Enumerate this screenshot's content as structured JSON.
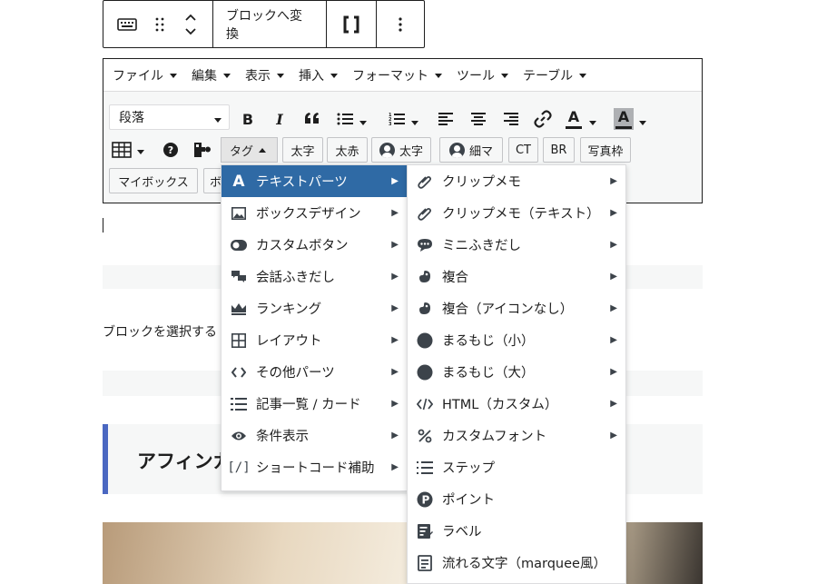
{
  "block_toolbar": {
    "convert_label": "ブロックへ変換",
    "bracket_label": "[ ]"
  },
  "classic_menu": [
    {
      "label": "ファイル"
    },
    {
      "label": "編集"
    },
    {
      "label": "表示"
    },
    {
      "label": "挿入"
    },
    {
      "label": "フォーマット"
    },
    {
      "label": "ツール"
    },
    {
      "label": "テーブル"
    }
  ],
  "toolbar": {
    "format_select": "段落",
    "bold": "B",
    "italic": "I",
    "quote": "❝",
    "link": "🔗",
    "text_color": "A",
    "bg_color": "A",
    "help": "?"
  },
  "quicktags": {
    "tag": "タグ",
    "bold_text": "太字",
    "bold_red": "太赤",
    "avatar_bold": "太字",
    "avatar_thin": "細マ",
    "ct": "CT",
    "br": "BR",
    "photo_frame": "写真枠",
    "mybox": "マイボックス",
    "next_partial": "ボ"
  },
  "page": {
    "prompt_text": "ブロックを選択する",
    "heading_text": "アフィンガ"
  },
  "menu1": [
    {
      "label": "テキストパーツ",
      "icon": "A",
      "icon_name": "text-a-icon",
      "submenu": true,
      "active": true
    },
    {
      "label": "ボックスデザイン",
      "icon": "box",
      "icon_name": "image-box-icon",
      "submenu": true
    },
    {
      "label": "カスタムボタン",
      "icon": "toggle",
      "icon_name": "toggle-icon",
      "submenu": true
    },
    {
      "label": "会話ふきだし",
      "icon": "chat",
      "icon_name": "chat-bubbles-icon",
      "submenu": true
    },
    {
      "label": "ランキング",
      "icon": "crown",
      "icon_name": "crown-icon",
      "submenu": true
    },
    {
      "label": "レイアウト",
      "icon": "grid",
      "icon_name": "grid-icon",
      "submenu": true
    },
    {
      "label": "その他パーツ",
      "icon": "code",
      "icon_name": "code-brackets-icon",
      "submenu": true
    },
    {
      "label": "記事一覧 / カード",
      "icon": "list",
      "icon_name": "list-icon",
      "submenu": true
    },
    {
      "label": "条件表示",
      "icon": "eye",
      "icon_name": "eye-icon",
      "submenu": true
    },
    {
      "label": "ショートコード補助",
      "icon": "shortcode",
      "icon_name": "shortcode-icon",
      "submenu": true
    }
  ],
  "menu2": [
    {
      "label": "クリップメモ",
      "icon": "clip",
      "icon_name": "paperclip-icon",
      "submenu": true
    },
    {
      "label": "クリップメモ（テキスト）",
      "icon": "clip",
      "icon_name": "paperclip-icon",
      "submenu": true
    },
    {
      "label": "ミニふきだし",
      "icon": "speech",
      "icon_name": "speech-bubble-icon",
      "submenu": true
    },
    {
      "label": "複合",
      "icon": "blob",
      "icon_name": "blob-icon",
      "submenu": true
    },
    {
      "label": "複合（アイコンなし）",
      "icon": "blob",
      "icon_name": "blob-icon",
      "submenu": true
    },
    {
      "label": "まるもじ（小）",
      "icon": "circle",
      "icon_name": "filled-circle-icon",
      "submenu": true
    },
    {
      "label": "まるもじ（大）",
      "icon": "circle",
      "icon_name": "filled-circle-icon",
      "submenu": true
    },
    {
      "label": "HTML（カスタム）",
      "icon": "html",
      "icon_name": "html-code-icon",
      "submenu": true
    },
    {
      "label": "カスタムフォント",
      "icon": "percent",
      "icon_name": "percent-icon",
      "submenu": true
    },
    {
      "label": "ステップ",
      "icon": "steps",
      "icon_name": "numbered-list-icon",
      "submenu": false
    },
    {
      "label": "ポイント",
      "icon": "point",
      "icon_name": "point-p-icon",
      "submenu": false
    },
    {
      "label": "ラベル",
      "icon": "label",
      "icon_name": "label-edit-icon",
      "submenu": false
    },
    {
      "label": "流れる文字（marquee風）",
      "icon": "marquee",
      "icon_name": "marquee-doc-icon",
      "submenu": false
    }
  ],
  "colors": {
    "active_bg": "#2f6aa5",
    "heading_accent": "#4a67c1",
    "icon_dark": "#3c434a"
  }
}
